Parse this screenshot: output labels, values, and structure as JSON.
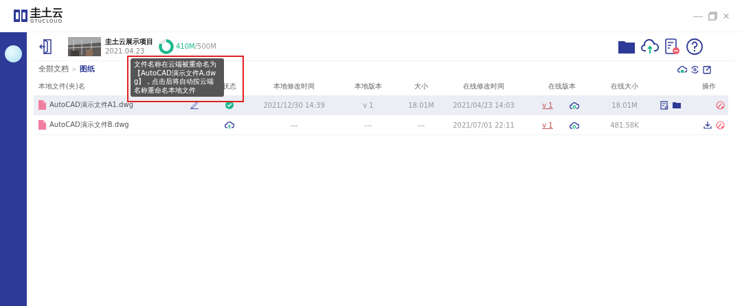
{
  "app": {
    "name": "圭土云",
    "subtitle": "GTUCLOUD"
  },
  "window_controls": [
    "—",
    "×"
  ],
  "project": {
    "name": "圭土云展示项目",
    "date": "2021.04.23",
    "storage": {
      "level": 0.82,
      "used": "410M",
      "total": "/500M"
    }
  },
  "breadcrumb": [
    {
      "label": "全部文档",
      "selected": false
    },
    {
      "label": ">",
      "kind": "separator"
    },
    {
      "label": "图纸",
      "selected": true
    }
  ],
  "table": {
    "columns": [
      "本地文件(夹)名",
      "",
      "状态",
      "本地修改时间",
      "本地版本",
      "大小",
      "在线修改时间",
      "在线版本",
      "在线大小",
      "操作"
    ],
    "rows": [
      {
        "selected": true,
        "name": "AutoCAD演示文件A1.dwg",
        "renamed": true,
        "status": {
          "kind": "synced"
        },
        "local_time": "2021/12/30 14:39",
        "local_version": "v 1",
        "size": "18.01M",
        "online_time": "2021/04/23 14:03",
        "online_version": "v 1",
        "online_size": "18.01M",
        "actions": [
          {
            "kind": "details"
          },
          {
            "kind": "folder"
          },
          {
            "kind": "unlink"
          }
        ]
      },
      {
        "selected": false,
        "name": "AutoCAD演示文件B.dwg",
        "renamed": false,
        "status": {
          "kind": "upload"
        },
        "local_time": "---",
        "local_version": "---",
        "size": "---",
        "online_time": "2021/07/01 22:11",
        "online_version": "v 1",
        "online_size": "481.58K",
        "actions": [
          {
            "kind": "download"
          },
          {
            "kind": "unlink"
          }
        ]
      }
    ]
  },
  "tooltip": {
    "text": "文件名称在云端被重命名为【AutoCAD演示文件A.dwg】，点击后将自动按云端名称重命名本地文件"
  }
}
